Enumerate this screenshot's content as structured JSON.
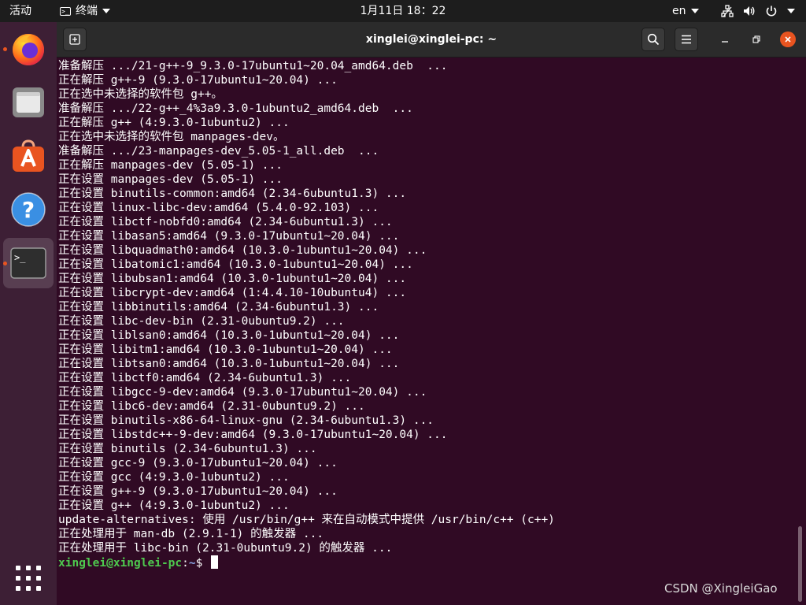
{
  "topbar": {
    "activities": "活动",
    "app_name": "终端",
    "clock": "1月11日  18：22",
    "lang": "en"
  },
  "dock": {
    "items": [
      {
        "name": "firefox",
        "icon": "firefox-icon",
        "running": true
      },
      {
        "name": "files",
        "icon": "files-icon",
        "running": false
      },
      {
        "name": "software",
        "icon": "ubuntu-software-icon",
        "running": false
      },
      {
        "name": "help",
        "icon": "help-icon",
        "running": false
      },
      {
        "name": "terminal",
        "icon": "terminal-icon",
        "running": true,
        "active": true
      }
    ]
  },
  "window": {
    "title": "xinglei@xinglei-pc: ~"
  },
  "terminal": {
    "lines": [
      "准备解压 .../21-g++-9_9.3.0-17ubuntu1~20.04_amd64.deb  ...",
      "正在解压 g++-9 (9.3.0-17ubuntu1~20.04) ...",
      "正在选中未选择的软件包 g++。",
      "准备解压 .../22-g++_4%3a9.3.0-1ubuntu2_amd64.deb  ...",
      "正在解压 g++ (4:9.3.0-1ubuntu2) ...",
      "正在选中未选择的软件包 manpages-dev。",
      "准备解压 .../23-manpages-dev_5.05-1_all.deb  ...",
      "正在解压 manpages-dev (5.05-1) ...",
      "正在设置 manpages-dev (5.05-1) ...",
      "正在设置 binutils-common:amd64 (2.34-6ubuntu1.3) ...",
      "正在设置 linux-libc-dev:amd64 (5.4.0-92.103) ...",
      "正在设置 libctf-nobfd0:amd64 (2.34-6ubuntu1.3) ...",
      "正在设置 libasan5:amd64 (9.3.0-17ubuntu1~20.04) ...",
      "正在设置 libquadmath0:amd64 (10.3.0-1ubuntu1~20.04) ...",
      "正在设置 libatomic1:amd64 (10.3.0-1ubuntu1~20.04) ...",
      "正在设置 libubsan1:amd64 (10.3.0-1ubuntu1~20.04) ...",
      "正在设置 libcrypt-dev:amd64 (1:4.4.10-10ubuntu4) ...",
      "正在设置 libbinutils:amd64 (2.34-6ubuntu1.3) ...",
      "正在设置 libc-dev-bin (2.31-0ubuntu9.2) ...",
      "正在设置 liblsan0:amd64 (10.3.0-1ubuntu1~20.04) ...",
      "正在设置 libitm1:amd64 (10.3.0-1ubuntu1~20.04) ...",
      "正在设置 libtsan0:amd64 (10.3.0-1ubuntu1~20.04) ...",
      "正在设置 libctf0:amd64 (2.34-6ubuntu1.3) ...",
      "正在设置 libgcc-9-dev:amd64 (9.3.0-17ubuntu1~20.04) ...",
      "正在设置 libc6-dev:amd64 (2.31-0ubuntu9.2) ...",
      "正在设置 binutils-x86-64-linux-gnu (2.34-6ubuntu1.3) ...",
      "正在设置 libstdc++-9-dev:amd64 (9.3.0-17ubuntu1~20.04) ...",
      "正在设置 binutils (2.34-6ubuntu1.3) ...",
      "正在设置 gcc-9 (9.3.0-17ubuntu1~20.04) ...",
      "正在设置 gcc (4:9.3.0-1ubuntu2) ...",
      "正在设置 g++-9 (9.3.0-17ubuntu1~20.04) ...",
      "正在设置 g++ (4:9.3.0-1ubuntu2) ...",
      "update-alternatives: 使用 /usr/bin/g++ 来在自动模式中提供 /usr/bin/c++ (c++)",
      "正在处理用于 man-db (2.9.1-1) 的触发器 ...",
      "正在处理用于 libc-bin (2.31-0ubuntu9.2) 的触发器 ..."
    ],
    "prompt": {
      "user_host": "xinglei@xinglei-pc",
      "separator": ":",
      "path": "~",
      "symbol": "$ "
    }
  },
  "watermark": "CSDN @XingleiGao",
  "colors": {
    "terminal_bg": "#300a24",
    "prompt_user": "#4ec94e",
    "prompt_path": "#8aa6e6",
    "accent": "#e95420"
  }
}
